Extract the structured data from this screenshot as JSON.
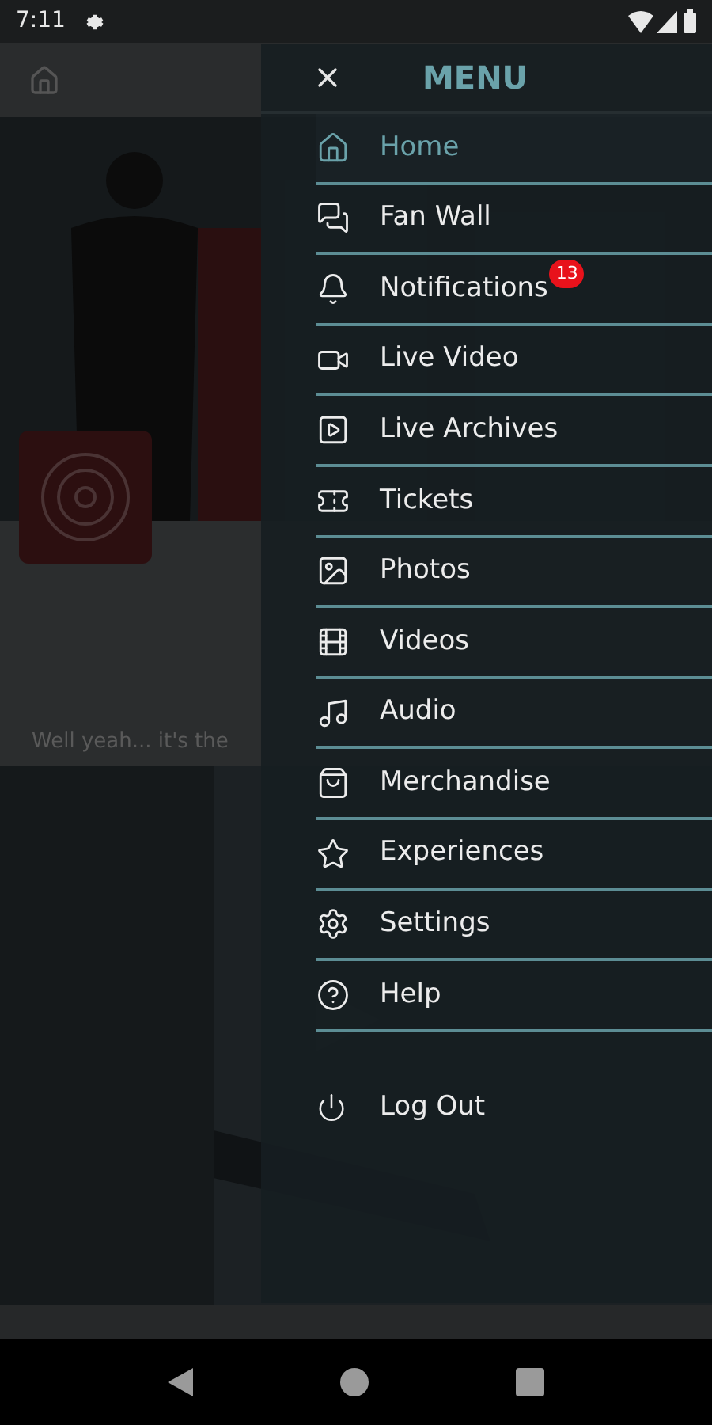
{
  "status_bar": {
    "time": "7:11"
  },
  "background": {
    "caption": "Well yeah... it's the"
  },
  "menu": {
    "title": "MENU",
    "items": [
      {
        "label": "Home",
        "selected": true
      },
      {
        "label": "Fan Wall",
        "selected": false
      },
      {
        "label": "Notifications",
        "selected": false,
        "badge": "13"
      },
      {
        "label": "Live Video",
        "selected": false
      },
      {
        "label": "Live Archives",
        "selected": false
      },
      {
        "label": "Tickets",
        "selected": false
      },
      {
        "label": "Photos",
        "selected": false
      },
      {
        "label": "Videos",
        "selected": false
      },
      {
        "label": "Audio",
        "selected": false
      },
      {
        "label": "Merchandise",
        "selected": false
      },
      {
        "label": "Experiences",
        "selected": false
      },
      {
        "label": "Settings",
        "selected": false
      },
      {
        "label": "Help",
        "selected": false
      }
    ],
    "logout": {
      "label": "Log Out"
    }
  }
}
